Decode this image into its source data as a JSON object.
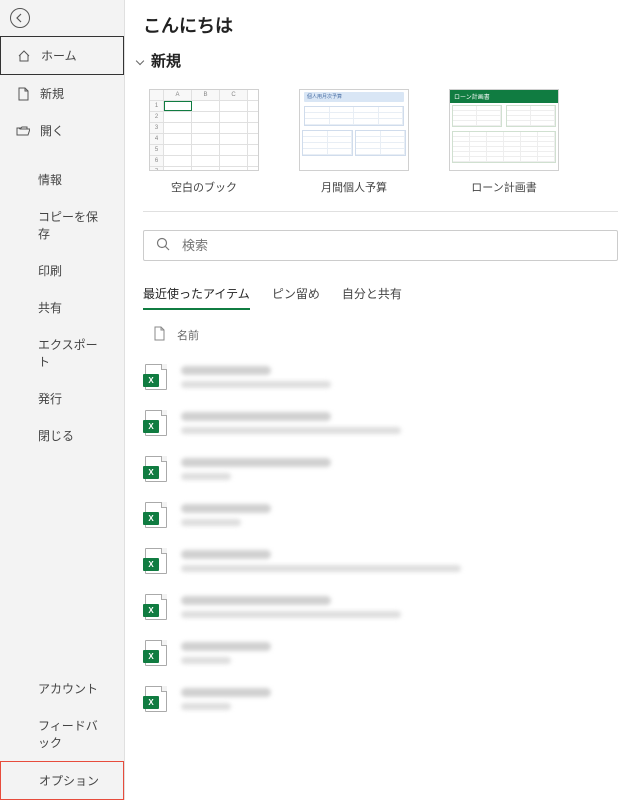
{
  "page_title": "こんにちは",
  "sidebar": {
    "home": "ホーム",
    "new": "新規",
    "open": "開く",
    "info": "情報",
    "save_copy": "コピーを保存",
    "print": "印刷",
    "share": "共有",
    "export": "エクスポート",
    "publish": "発行",
    "close": "閉じる",
    "account": "アカウント",
    "feedback": "フィードバック",
    "options": "オプション"
  },
  "section_new": "新規",
  "templates": {
    "blank": "空白のブック",
    "budget": "月間個人予算",
    "budget_header": "個人用月次予算",
    "loan": "ローン計画書",
    "loan_header": "ローン計画書"
  },
  "search": {
    "placeholder": "検索"
  },
  "tabs": {
    "recent": "最近使ったアイテム",
    "pinned": "ピン留め",
    "shared": "自分と共有"
  },
  "list_header": {
    "name": "名前"
  }
}
